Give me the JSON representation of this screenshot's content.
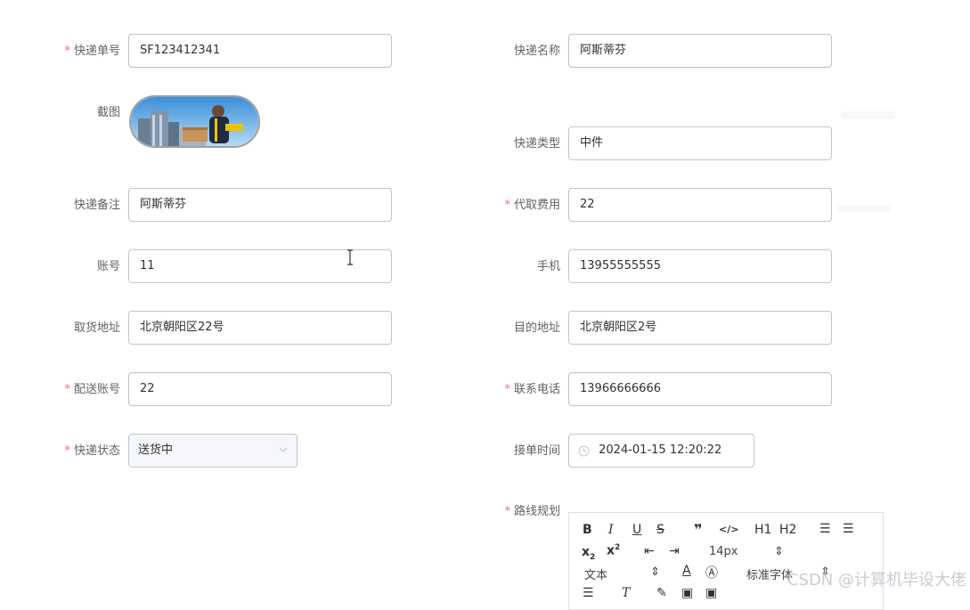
{
  "form": {
    "tracking_no": {
      "label": "快递单号",
      "value": "SF123412341",
      "required": true
    },
    "courier_name": {
      "label": "快递名称",
      "value": "阿斯蒂芬",
      "required": false
    },
    "screenshot": {
      "label": "截图"
    },
    "courier_type": {
      "label": "快递类型",
      "value": "中件",
      "required": false
    },
    "remark": {
      "label": "快递备注",
      "value": "阿斯蒂芬",
      "required": false
    },
    "fee": {
      "label": "代取费用",
      "value": "22",
      "required": true
    },
    "account": {
      "label": "账号",
      "value": "11",
      "required": false
    },
    "phone": {
      "label": "手机",
      "value": "13955555555",
      "required": false
    },
    "pickup_address": {
      "label": "取货地址",
      "value": "北京朝阳区22号",
      "required": false
    },
    "destination": {
      "label": "目的地址",
      "value": "北京朝阳区2号",
      "required": false
    },
    "delivery_account": {
      "label": "配送账号",
      "value": "22",
      "required": true
    },
    "contact_phone": {
      "label": "联系电话",
      "value": "13966666666",
      "required": true
    },
    "status": {
      "label": "快递状态",
      "value": "送货中",
      "required": true
    },
    "order_time": {
      "label": "接单时间",
      "value": "2024-01-15 12:20:22",
      "required": false
    },
    "route": {
      "label": "路线规划",
      "required": true
    }
  },
  "editor": {
    "font_size": "14px",
    "text_style": "文本",
    "font_family": "标准字体",
    "h1": "H1",
    "h2": "H2"
  },
  "watermark": "CSDN @计算机毕设大佬"
}
